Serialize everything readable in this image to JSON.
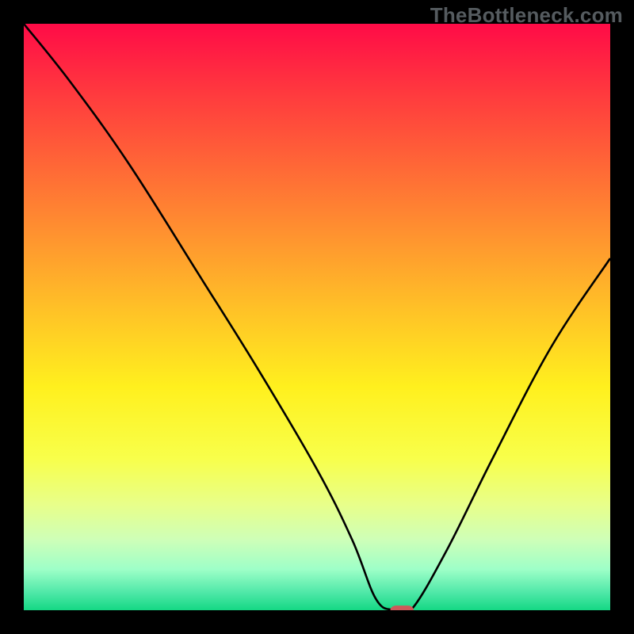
{
  "watermark": "TheBottleneck.com",
  "chart_data": {
    "type": "line",
    "title": "",
    "xlabel": "",
    "ylabel": "",
    "xlim": [
      0,
      100
    ],
    "ylim": [
      0,
      100
    ],
    "series": [
      {
        "name": "curve",
        "x": [
          0,
          8,
          18,
          30,
          40,
          50,
          56,
          60,
          63,
          66,
          72,
          80,
          90,
          100
        ],
        "y": [
          100,
          90,
          76,
          57,
          41,
          24,
          12,
          2,
          0,
          0,
          10,
          26,
          45,
          60
        ]
      }
    ],
    "marker": {
      "x_center": 64.5,
      "y": 0,
      "width": 4,
      "height": 1.6,
      "rx": 1.0
    },
    "colors": {
      "gradient_stops": [
        {
          "offset": 0.0,
          "color": "#ff0b47"
        },
        {
          "offset": 0.12,
          "color": "#ff3a3e"
        },
        {
          "offset": 0.25,
          "color": "#ff6a36"
        },
        {
          "offset": 0.38,
          "color": "#ff9a2e"
        },
        {
          "offset": 0.5,
          "color": "#ffc626"
        },
        {
          "offset": 0.62,
          "color": "#fff01e"
        },
        {
          "offset": 0.74,
          "color": "#f8ff4a"
        },
        {
          "offset": 0.82,
          "color": "#e8ff8a"
        },
        {
          "offset": 0.88,
          "color": "#ceffb8"
        },
        {
          "offset": 0.93,
          "color": "#9effc8"
        },
        {
          "offset": 0.97,
          "color": "#4fe8a8"
        },
        {
          "offset": 1.0,
          "color": "#14d884"
        }
      ],
      "curve": "#000000",
      "marker": "#cc5a5a"
    }
  }
}
